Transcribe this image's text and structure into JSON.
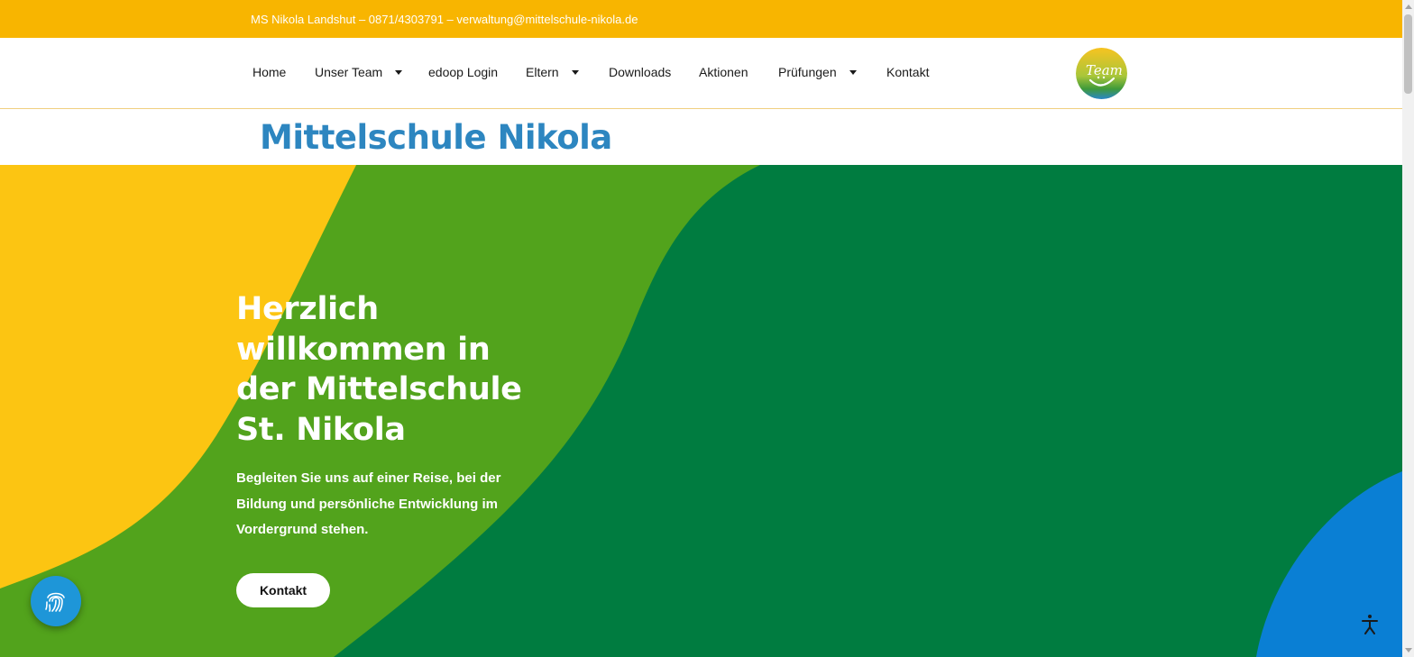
{
  "topbar": {
    "contact_line": "MS Nikola Landshut – 0871/4303791 – verwaltung@mittelschule-nikola.de"
  },
  "nav": {
    "items": [
      {
        "label": "Home"
      },
      {
        "label": "Unser Team"
      },
      {
        "label": "edoop Login"
      },
      {
        "label": "Eltern"
      },
      {
        "label": "Downloads"
      },
      {
        "label": "Aktionen"
      },
      {
        "label": "Prüfungen"
      },
      {
        "label": "Kontakt"
      }
    ],
    "logo_text": "Team"
  },
  "site": {
    "title": "Mittelschule Nikola"
  },
  "hero": {
    "heading": "Herzlich willkommen in der Mittelschule St. Nikola",
    "subtext": "Begleiten Sie uns auf einer Reise, bei der Bildung und persönliche Entwicklung im Vordergrund stehen.",
    "button_label": "Kontakt"
  },
  "colors": {
    "topbar": "#f8b500",
    "title_blue": "#2d86c0",
    "hero_yellow": "#fcc512",
    "hero_light_green": "#52a31c",
    "hero_dark_green": "#007c40",
    "hero_blue": "#0a7fd4",
    "fingerprint_button": "#1e96d8"
  },
  "icons": {
    "dropdown": "chevron-down-icon",
    "floating": "fingerprint-icon",
    "accessibility": "accessibility-icon"
  }
}
